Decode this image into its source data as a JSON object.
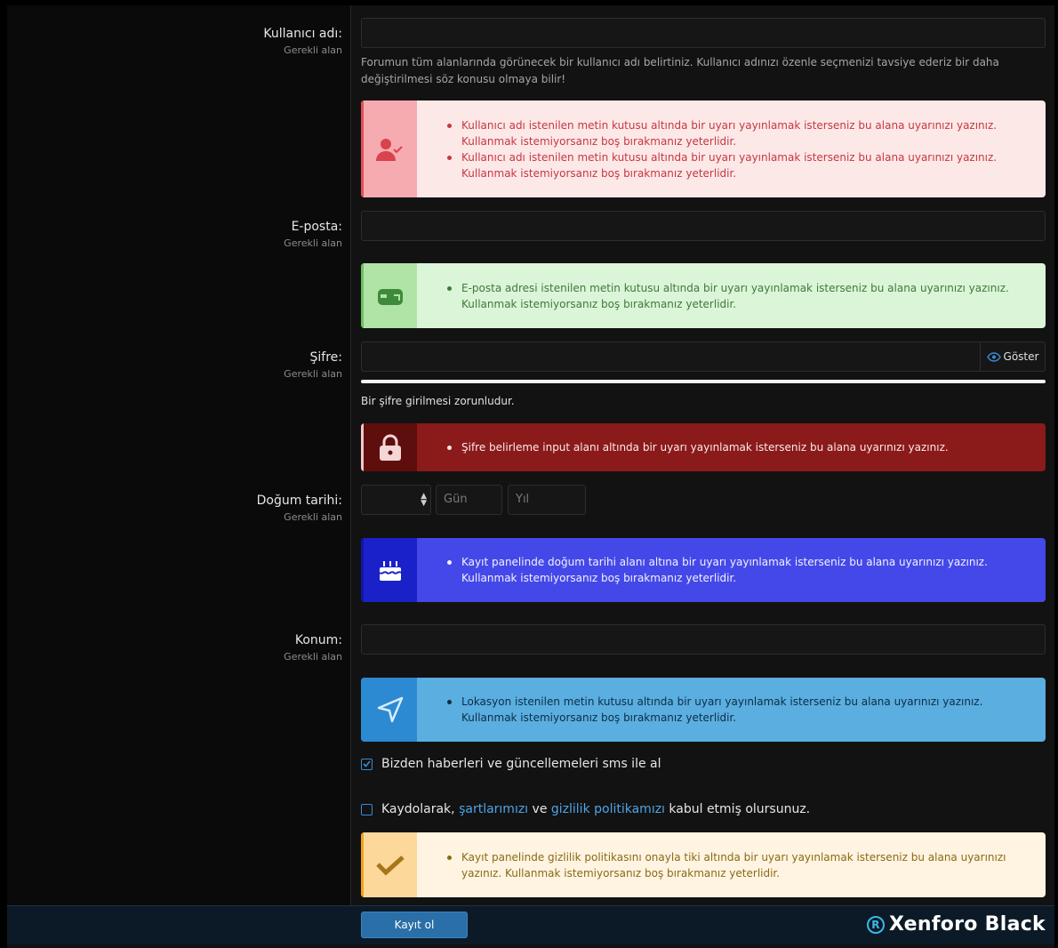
{
  "fields": {
    "username": {
      "label": "Kullanıcı adı:",
      "required": "Gerekli alan",
      "value": "",
      "hint": "Forumun tüm alanlarında görünecek bir kullanıcı adı belirtiniz. Kullanıcı adınızı özenle seçmenizi tavsiye ederiz bir daha değiştirilmesi söz konusu olmaya bilir!"
    },
    "email": {
      "label": "E-posta:",
      "required": "Gerekli alan",
      "value": ""
    },
    "password": {
      "label": "Şifre:",
      "required": "Gerekli alan",
      "value": "",
      "show_label": "Göster",
      "hint": "Bir şifre girilmesi zorunludur."
    },
    "dob": {
      "label": "Doğum tarihi:",
      "required": "Gerekli alan",
      "month": "",
      "day_placeholder": "Gün",
      "year_placeholder": "Yıl"
    },
    "location": {
      "label": "Konum:",
      "required": "Gerekli alan",
      "value": ""
    }
  },
  "alerts": {
    "username": {
      "icon": "user-check-icon",
      "items": [
        "Kullanıcı adı istenilen metin kutusu altında bir uyarı yayınlamak isterseniz bu alana uyarınızı yazınız. Kullanmak istemiyorsanız boş bırakmanız yeterlidir.",
        "Kullanıcı adı istenilen metin kutusu altında bir uyarı yayınlamak isterseniz bu alana uyarınızı yazınız. Kullanmak istemiyorsanız boş bırakmanız yeterlidir."
      ]
    },
    "email": {
      "icon": "mailbox-icon",
      "items": [
        "E-posta adresi istenilen metin kutusu altında bir uyarı yayınlamak isterseniz bu alana uyarınızı yazınız. Kullanmak istemiyorsanız boş bırakmanız yeterlidir."
      ]
    },
    "password": {
      "icon": "lock-icon",
      "items": [
        "Şifre belirleme input alanı altında bir uyarı yayınlamak isterseniz bu alana uyarınızı yazınız."
      ]
    },
    "dob": {
      "icon": "birthday-cake-icon",
      "items": [
        "Kayıt panelinde doğum tarihi alanı altına bir uyarı yayınlamak isterseniz bu alana uyarınızı yazınız. Kullanmak istemiyorsanız boş bırakmanız yeterlidir."
      ]
    },
    "location": {
      "icon": "location-arrow-icon",
      "items": [
        "Lokasyon istenilen metin kutusu altında bir uyarı yayınlamak isterseniz bu alana uyarınızı yazınız. Kullanmak istemiyorsanız boş bırakmanız yeterlidir."
      ]
    },
    "privacy": {
      "icon": "checkmark-icon",
      "items": [
        "Kayıt panelinde gizlilik politikasını onayla tiki altında bir uyarı yayınlamak isterseniz bu alana uyarınızı yazınız. Kullanmak istemiyorsanız boş bırakmanız yeterlidir."
      ]
    }
  },
  "checkboxes": {
    "sms": {
      "label": "Bizden haberleri ve güncellemeleri sms ile al",
      "checked": true
    },
    "terms": {
      "prefix": "Kaydolarak,",
      "terms_link": "şartlarımızı",
      "middle": "ve",
      "privacy_link": "gizlilik politikamızı",
      "suffix": "kabul etmiş olursunuz.",
      "checked": false
    }
  },
  "footer": {
    "submit_label": "Kayıt ol",
    "brand_mark": "R",
    "brand_name": "Xenforo Black"
  }
}
